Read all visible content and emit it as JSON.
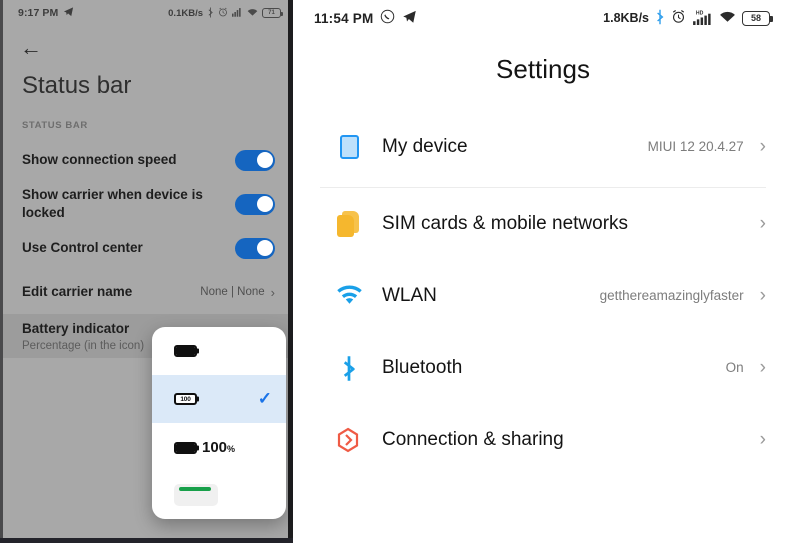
{
  "left_panel": {
    "status_bar": {
      "time": "9:17 PM",
      "telegram_icon": "telegram-icon",
      "net_speed": "0.1KB/s",
      "bluetooth_icon": "bluetooth-icon",
      "alarm_icon": "alarm-icon",
      "signal_icon": "cellular-signal-icon",
      "wifi_icon": "wifi-icon",
      "battery_level": "71"
    },
    "back_icon": "back-arrow-icon",
    "title": "Status bar",
    "section_header": "STATUS BAR",
    "rows": [
      {
        "title": "Show connection speed",
        "type": "toggle",
        "on": true
      },
      {
        "title": "Show carrier when device is locked",
        "type": "toggle",
        "on": true
      },
      {
        "title": "Use Control center",
        "type": "toggle",
        "on": true
      },
      {
        "title": "Edit carrier name",
        "type": "value",
        "value": "None | None"
      },
      {
        "title": "Battery indicator",
        "subtitle": "Percentage (in the icon)",
        "type": "pressed"
      }
    ],
    "battery_popup": {
      "options": [
        {
          "glyph": "battery-filled-icon",
          "label": "",
          "selected": false
        },
        {
          "glyph": "battery-percentage-inside-icon",
          "label": "100",
          "selected": true
        },
        {
          "glyph": "battery-percentage-outside-icon",
          "label": "100",
          "label_suffix": "%",
          "selected": false
        },
        {
          "glyph": "battery-graphic-bar-icon",
          "label": "",
          "selected": false
        }
      ],
      "check_icon": "checkmark-icon"
    }
  },
  "right_panel": {
    "status_bar": {
      "time": "11:54 PM",
      "whatsapp_icon": "whatsapp-icon",
      "telegram_icon": "telegram-icon",
      "net_speed": "1.8KB/s",
      "bluetooth_icon": "bluetooth-icon",
      "alarm_icon": "alarm-icon",
      "hd_label": "HD",
      "signal_icon": "cellular-signal-icon",
      "wifi_icon": "wifi-icon",
      "battery_level": "58"
    },
    "title": "Settings",
    "items": [
      {
        "icon": "my-device-icon",
        "label": "My device",
        "value": "MIUI 12 20.4.27",
        "chevron": "chevron-right-icon"
      },
      {
        "icon": "sim-cards-icon",
        "label": "SIM cards & mobile networks",
        "value": "",
        "chevron": "chevron-right-icon"
      },
      {
        "icon": "wlan-icon",
        "label": "WLAN",
        "value": "getthereamazinglyfaster",
        "chevron": "chevron-right-icon"
      },
      {
        "icon": "bluetooth-icon",
        "label": "Bluetooth",
        "value": "On",
        "chevron": "chevron-right-icon"
      },
      {
        "icon": "connection-sharing-icon",
        "label": "Connection & sharing",
        "value": "",
        "chevron": "chevron-right-icon"
      }
    ]
  },
  "colors": {
    "accent_blue": "#1565c0",
    "settings_blue": "#2196f3",
    "sim_yellow": "#f5b72e",
    "connection_red": "#ef5b45",
    "selected_row": "#dbe9f8",
    "battery_green": "#18a04a"
  }
}
